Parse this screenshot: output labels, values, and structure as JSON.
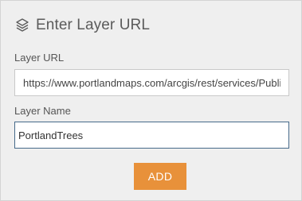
{
  "panel": {
    "title": "Enter Layer URL",
    "title_icon": "layers-icon"
  },
  "layer_url": {
    "label": "Layer URL",
    "value": "https://www.portlandmaps.com/arcgis/rest/services/Public"
  },
  "layer_name": {
    "label": "Layer Name",
    "value": "PortlandTrees"
  },
  "actions": {
    "add_label": "ADD"
  },
  "colors": {
    "panel_bg": "#efefef",
    "accent": "#e8913a",
    "focus_border": "#466a8a"
  }
}
